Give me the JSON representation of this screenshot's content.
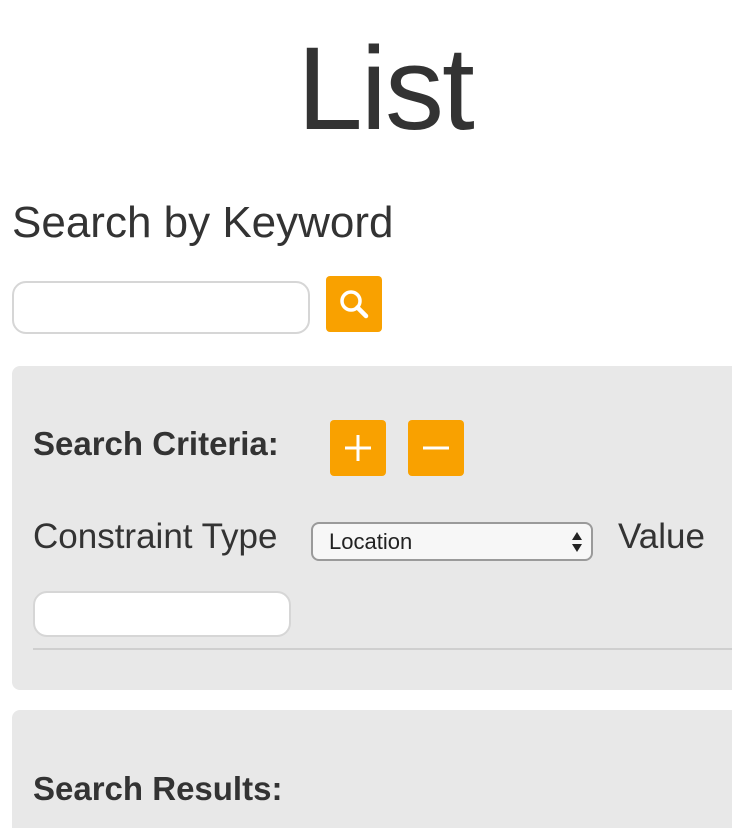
{
  "page": {
    "title": "List"
  },
  "keyword_search": {
    "heading": "Search by Keyword",
    "input_value": "",
    "input_placeholder": "",
    "button_icon": "search-icon"
  },
  "criteria": {
    "label": "Search Criteria:",
    "add_icon": "plus-icon",
    "remove_icon": "minus-icon",
    "constraint_type_label": "Constraint Type",
    "constraint_type_selected": "Location",
    "value_label": "Value",
    "value_input_value": ""
  },
  "results": {
    "label": "Search Results:"
  },
  "colors": {
    "accent": "#f9a100",
    "panel_bg": "#e8e8e8",
    "text": "#333333"
  }
}
